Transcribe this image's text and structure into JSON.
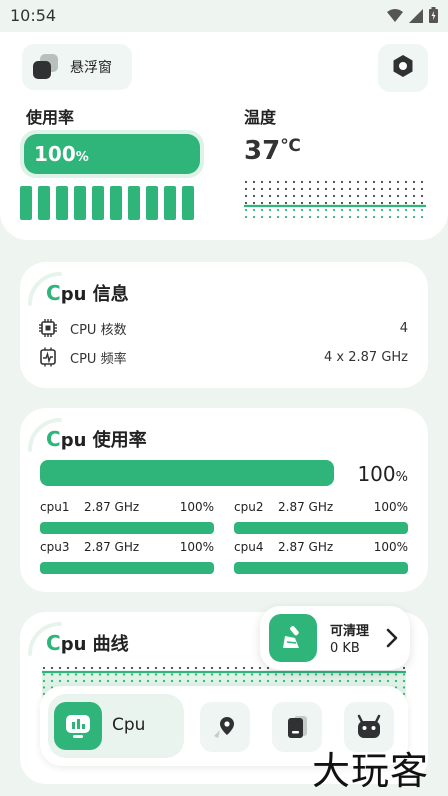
{
  "status_bar": {
    "time": "10:54"
  },
  "top": {
    "float_window_label": "悬浮窗",
    "usage_label": "使用率",
    "usage_value": "100",
    "usage_unit": "%",
    "temp_label": "温度",
    "temp_value": "37",
    "temp_unit": "℃"
  },
  "cpu_info": {
    "title_c": "C",
    "title_rest": "pu 信息",
    "rows": [
      {
        "label": "CPU 核数",
        "value": "4",
        "icon": "chip-icon"
      },
      {
        "label": "CPU 频率",
        "value": "4 x 2.87 GHz",
        "icon": "frequency-icon"
      }
    ]
  },
  "cpu_usage": {
    "title_c": "C",
    "title_rest": "pu 使用率",
    "total_value": "100",
    "total_unit": "%",
    "cores": [
      {
        "name": "cpu1",
        "freq": "2.87 GHz",
        "pct": "100%",
        "fill": 1.0
      },
      {
        "name": "cpu2",
        "freq": "2.87 GHz",
        "pct": "100%",
        "fill": 1.0
      },
      {
        "name": "cpu3",
        "freq": "2.87 GHz",
        "pct": "100%",
        "fill": 1.0
      },
      {
        "name": "cpu4",
        "freq": "2.87 GHz",
        "pct": "100%",
        "fill": 1.0
      }
    ]
  },
  "cpu_curve": {
    "title_c": "C",
    "title_rest": "pu 曲线"
  },
  "clean_popup": {
    "title": "可清理",
    "size": "0 KB"
  },
  "nav": {
    "active_label": "Cpu"
  },
  "watermark": "大玩客",
  "colors": {
    "accent": "#2fb47a",
    "accent_light": "#dff2e7",
    "background": "#eef5f1"
  }
}
